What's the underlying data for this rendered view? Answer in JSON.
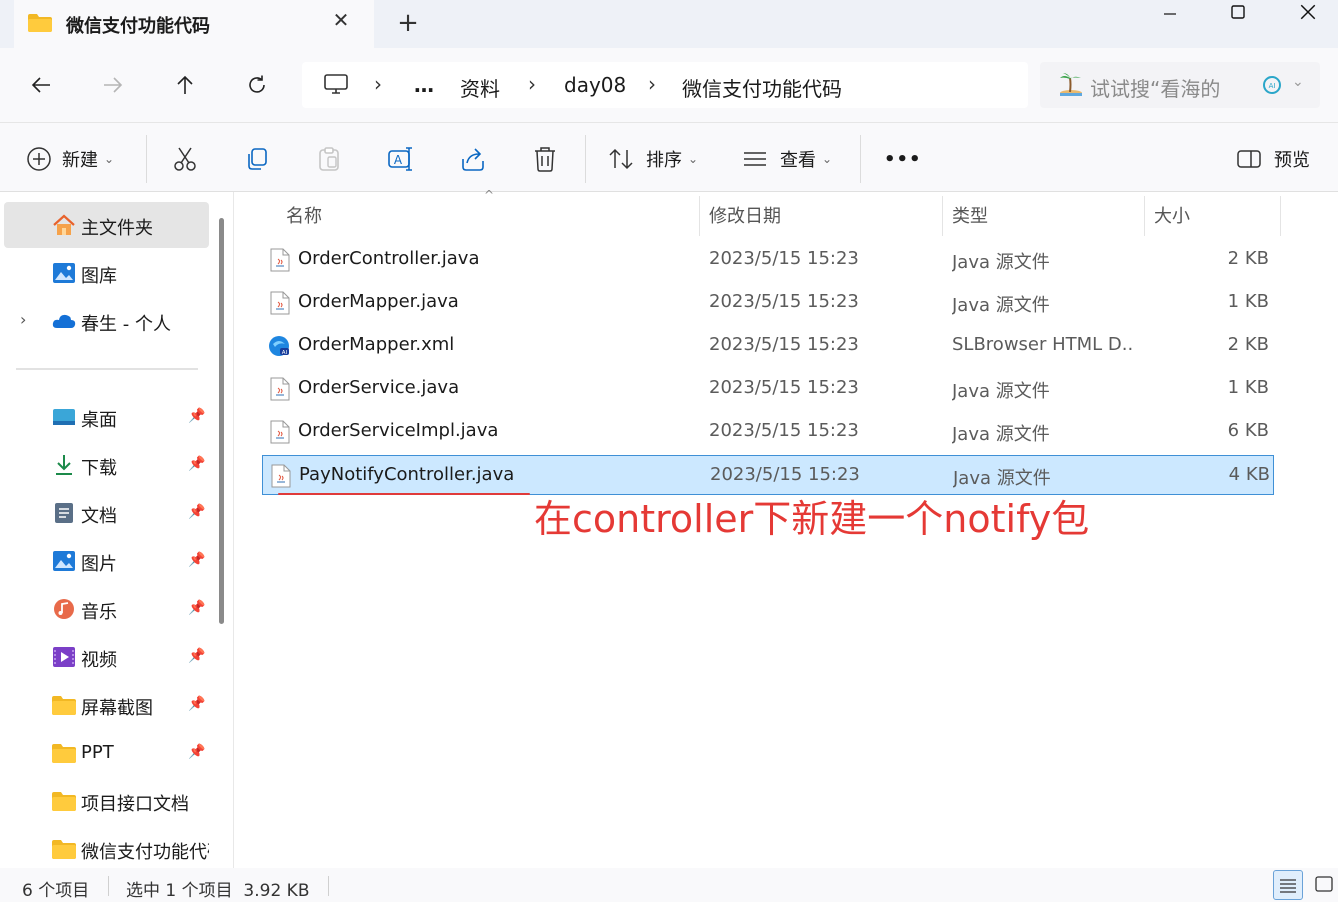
{
  "window": {
    "tab_title": "微信支付功能代码",
    "tab_close": "✕",
    "new_tab": "+",
    "min": "—",
    "max": "☐",
    "close": "✕"
  },
  "nav": {
    "back": "←",
    "forward": "→",
    "up": "↑",
    "refresh": "↻",
    "breadcrumbs": [
      "…",
      "资料",
      "day08",
      "微信支付功能代码"
    ],
    "search_placeholder": "试试搜“看海的"
  },
  "toolbar": {
    "new_label": "新建",
    "sort_label": "排序",
    "view_label": "查看",
    "more_label": "•••",
    "preview_label": "预览"
  },
  "sidebar": {
    "items": [
      {
        "label": "主文件夹",
        "icon": "home-icon",
        "selected": true
      },
      {
        "label": "图库",
        "icon": "gallery-icon"
      },
      {
        "label": "春生 - 个人",
        "icon": "onedrive-cloud-icon",
        "expandable": true
      },
      {
        "label": "桌面",
        "icon": "desktop-icon",
        "pinned": true
      },
      {
        "label": "下载",
        "icon": "download-icon",
        "pinned": true
      },
      {
        "label": "文档",
        "icon": "document-icon",
        "pinned": true
      },
      {
        "label": "图片",
        "icon": "pictures-icon",
        "pinned": true
      },
      {
        "label": "音乐",
        "icon": "music-icon",
        "pinned": true
      },
      {
        "label": "视频",
        "icon": "video-icon",
        "pinned": true
      },
      {
        "label": "屏幕截图",
        "icon": "folder-icon",
        "pinned": true
      },
      {
        "label": "PPT",
        "icon": "folder-icon",
        "pinned": true
      },
      {
        "label": "项目接口文档",
        "icon": "folder-icon"
      },
      {
        "label": "微信支付功能代码",
        "icon": "folder-icon"
      }
    ]
  },
  "columns": {
    "name": "名称",
    "date": "修改日期",
    "type": "类型",
    "size": "大小"
  },
  "files": [
    {
      "name": "OrderController.java",
      "date": "2023/5/15 15:23",
      "type": "Java 源文件",
      "size": "2 KB",
      "icon": "java-file-icon"
    },
    {
      "name": "OrderMapper.java",
      "date": "2023/5/15 15:23",
      "type": "Java 源文件",
      "size": "1 KB",
      "icon": "java-file-icon"
    },
    {
      "name": "OrderMapper.xml",
      "date": "2023/5/15 15:23",
      "type": "SLBrowser HTML D...",
      "size": "2 KB",
      "icon": "slbrowser-ai-icon"
    },
    {
      "name": "OrderService.java",
      "date": "2023/5/15 15:23",
      "type": "Java 源文件",
      "size": "1 KB",
      "icon": "java-file-icon"
    },
    {
      "name": "OrderServiceImpl.java",
      "date": "2023/5/15 15:23",
      "type": "Java 源文件",
      "size": "6 KB",
      "icon": "java-file-icon"
    },
    {
      "name": "PayNotifyController.java",
      "date": "2023/5/15 15:23",
      "type": "Java 源文件",
      "size": "4 KB",
      "icon": "java-file-icon",
      "selected": true
    }
  ],
  "annotation": "在controller下新建一个notify包",
  "status": {
    "item_count": "6 个项目",
    "selection": "选中 1 个项目  3.92 KB"
  },
  "colors": {
    "selection_bg": "#cce8ff",
    "selection_border": "#3f90d6",
    "annotation_red": "#e53935",
    "accent": "#0067c0"
  }
}
